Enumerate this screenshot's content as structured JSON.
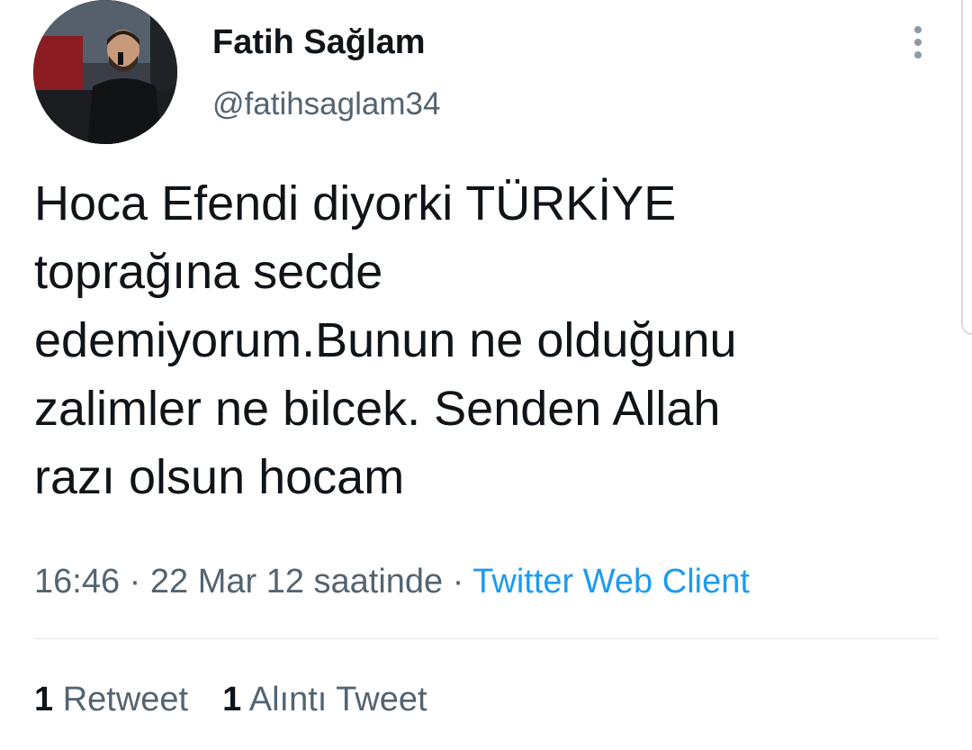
{
  "author": {
    "display_name": "Fatih Sağlam",
    "handle": "@fatihsaglam34"
  },
  "tweet": {
    "text": "Hoca Efendi diyorki TÜRKİYE\ntoprağına secde\nedemiyorum.Bunun ne olduğunu\nzalimler ne bilcek. Senden Allah\nrazı olsun hocam",
    "timestamp": "16:46 · 22 Mar 12 saatinde",
    "separator": " · ",
    "source": "Twitter Web Client"
  },
  "stats": {
    "retweets_count": "1",
    "retweets_label": "Retweet",
    "quotes_count": "1",
    "quotes_label": "Alıntı Tweet"
  },
  "icons": {
    "more": "more-vertical-icon"
  },
  "colors": {
    "text": "#0f1419",
    "secondary": "#536471",
    "link": "#1d9bf0",
    "divider": "#dfe3e7"
  }
}
